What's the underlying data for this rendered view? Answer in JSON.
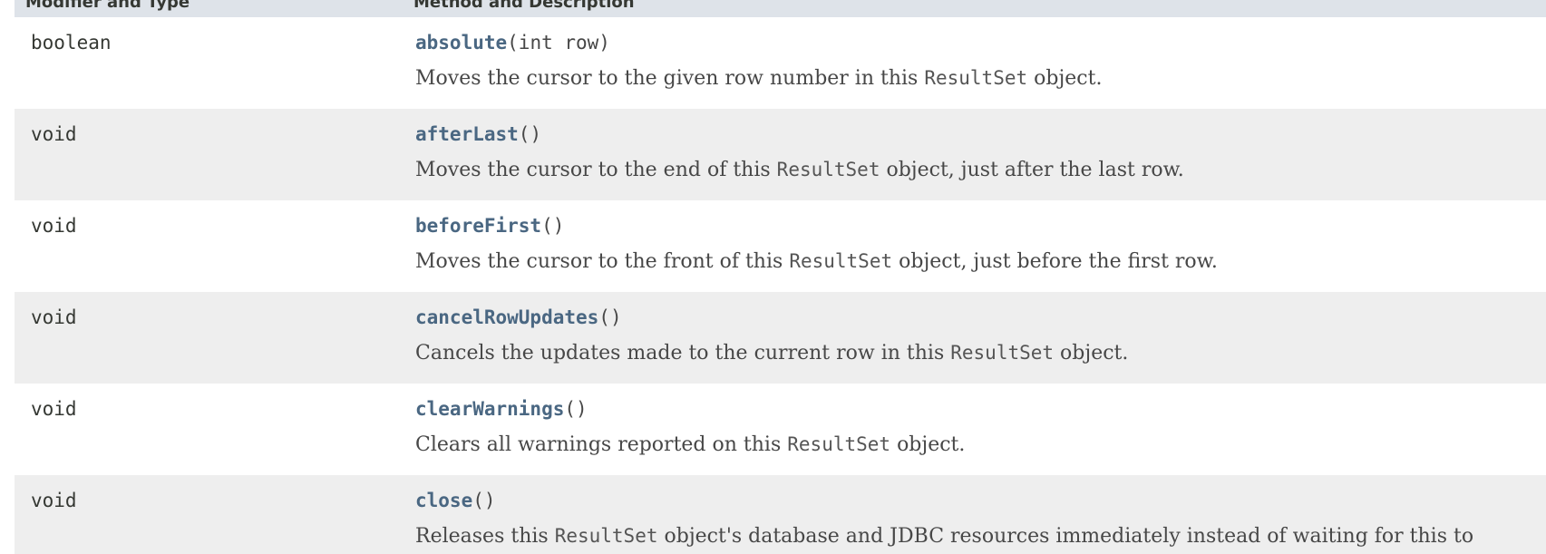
{
  "table": {
    "headers": {
      "type": "Modifier and Type",
      "method": "Method and Description"
    },
    "rows": [
      {
        "type": "boolean",
        "method": "absolute",
        "params": "(int row)",
        "desc_before": "Moves the cursor to the given row number in this",
        "desc_code": "ResultSet",
        "desc_after": "object."
      },
      {
        "type": "void",
        "method": "afterLast",
        "params": "()",
        "desc_before": "Moves the cursor to the end of this",
        "desc_code": "ResultSet",
        "desc_after": "object, just after the last row."
      },
      {
        "type": "void",
        "method": "beforeFirst",
        "params": "()",
        "desc_before": "Moves the cursor to the front of this",
        "desc_code": "ResultSet",
        "desc_after": "object, just before the first row."
      },
      {
        "type": "void",
        "method": "cancelRowUpdates",
        "params": "()",
        "desc_before": "Cancels the updates made to the current row in this",
        "desc_code": "ResultSet",
        "desc_after": "object."
      },
      {
        "type": "void",
        "method": "clearWarnings",
        "params": "()",
        "desc_before": "Clears all warnings reported on this",
        "desc_code": "ResultSet",
        "desc_after": "object."
      },
      {
        "type": "void",
        "method": "close",
        "params": "()",
        "desc_before": "Releases this",
        "desc_code": "ResultSet",
        "desc_after": "object's database and JDBC resources immediately instead of waiting for this to"
      }
    ]
  },
  "colors": {
    "header_bg": "#dee3e9",
    "row_alt": "#ffffff",
    "row_shaded": "#eeeeee",
    "link": "#4a6782",
    "text": "#474747"
  }
}
